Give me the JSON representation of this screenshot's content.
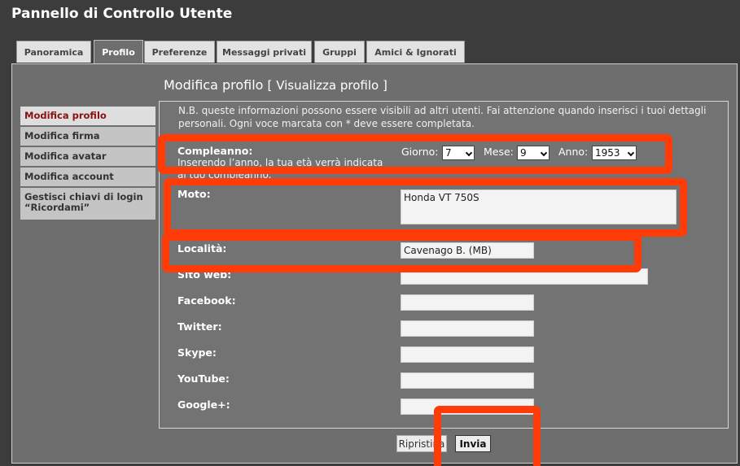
{
  "page": {
    "title": "Pannello di Controllo Utente"
  },
  "tabs": [
    {
      "label": "Panoramica"
    },
    {
      "label": "Profilo"
    },
    {
      "label": "Preferenze"
    },
    {
      "label": "Messaggi privati"
    },
    {
      "label": "Gruppi"
    },
    {
      "label": "Amici & Ignorati"
    }
  ],
  "active_tab": "Profilo",
  "heading": {
    "title": "Modifica profilo",
    "link_open": "[",
    "link_text": "Visualizza profilo",
    "link_close": "]"
  },
  "sidebar": {
    "items": [
      {
        "label": "Modifica profilo"
      },
      {
        "label": "Modifica firma"
      },
      {
        "label": "Modifica avatar"
      },
      {
        "label": "Modifica account"
      },
      {
        "label": "Gestisci chiavi di login “Ricordami”"
      }
    ]
  },
  "form": {
    "note": "N.B. queste informazioni possono essere visibili ad altri utenti. Fai attenzione quando inserisci i tuoi dettagli personali. Ogni voce marcata con * deve essere completata.",
    "birthday": {
      "label": "Compleanno:",
      "hint": "Inserendo l’anno, la tua età verrà indicata al tuo compleanno.",
      "day_label": "Giorno:",
      "day_value": "7",
      "month_label": "Mese:",
      "month_value": "9",
      "year_label": "Anno:",
      "year_value": "1953"
    },
    "moto": {
      "label": "Moto:",
      "value": "Honda VT 750S"
    },
    "location": {
      "label": "Località:",
      "value": "Cavenago B. (MB)"
    },
    "website": {
      "label": "Sito web:",
      "value": ""
    },
    "facebook": {
      "label": "Facebook:",
      "value": ""
    },
    "twitter": {
      "label": "Twitter:",
      "value": ""
    },
    "skype": {
      "label": "Skype:",
      "value": ""
    },
    "youtube": {
      "label": "YouTube:",
      "value": ""
    },
    "googleplus": {
      "label": "Google+:",
      "value": ""
    }
  },
  "buttons": {
    "reset": "Ripristina",
    "submit": "Invia"
  },
  "colors": {
    "annotation": "#ff3b08",
    "active_menu_text": "#8b1010",
    "background": "#3c3c3c",
    "panel": "#6e6e6e"
  }
}
